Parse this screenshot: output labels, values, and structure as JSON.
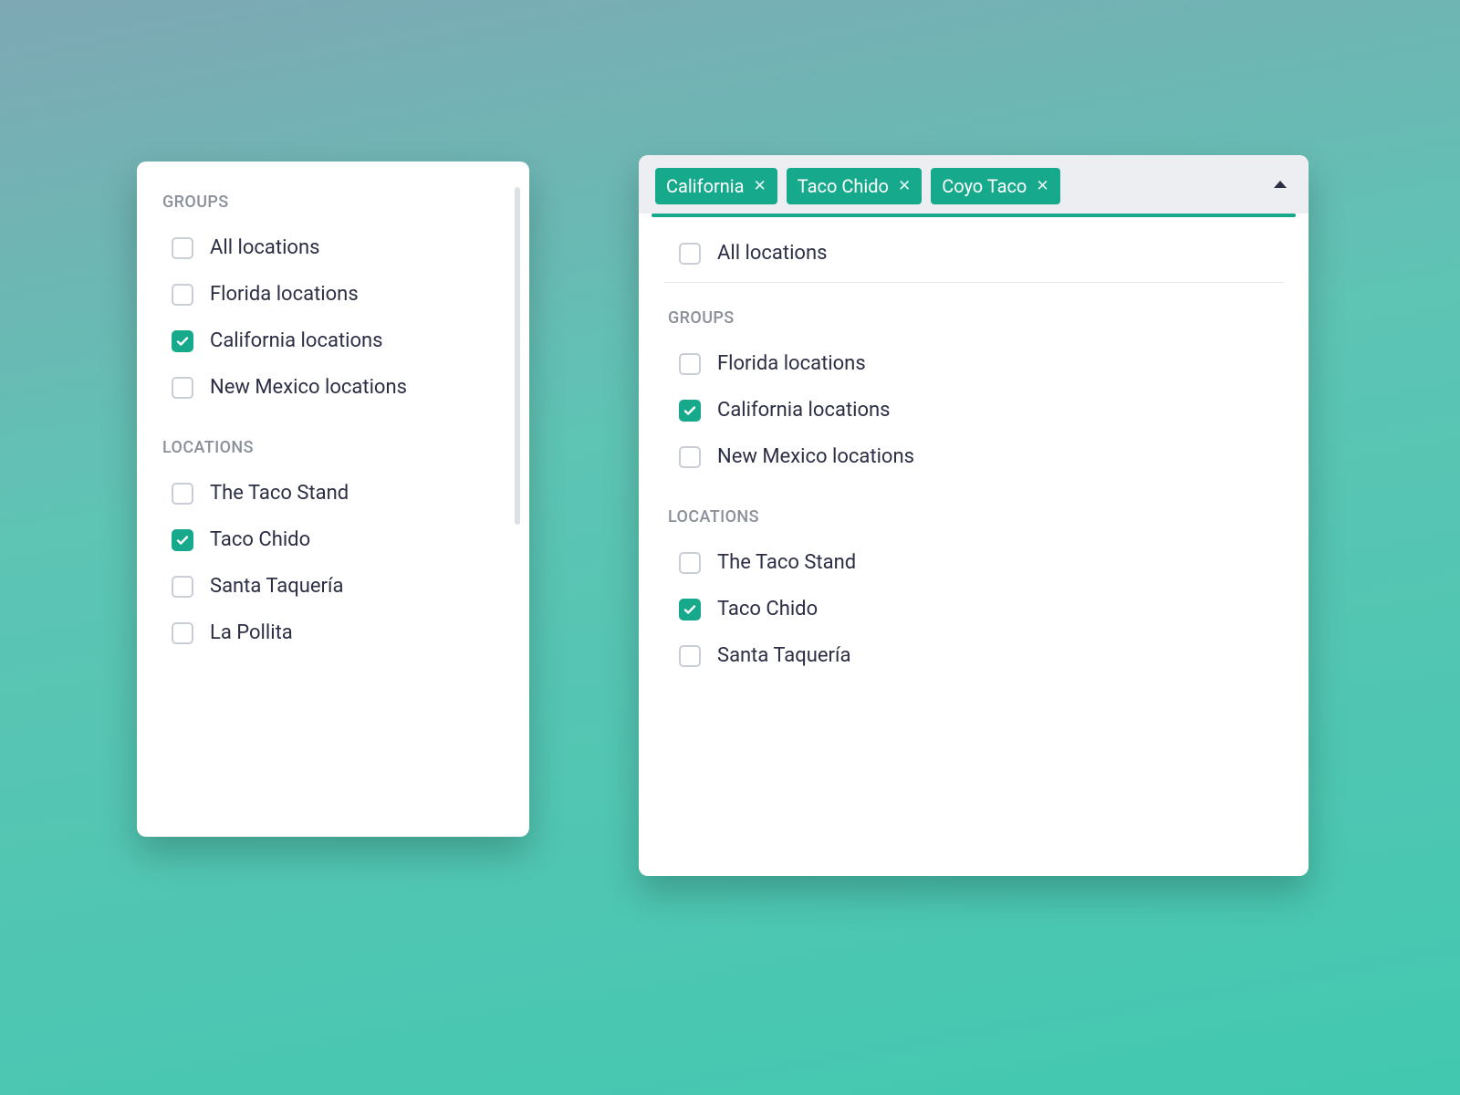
{
  "colors": {
    "accent": "#17a98c"
  },
  "panel_small": {
    "sections": [
      {
        "header": "GROUPS",
        "items": [
          {
            "label": "All locations",
            "checked": false
          },
          {
            "label": "Florida locations",
            "checked": false
          },
          {
            "label": "California locations",
            "checked": true
          },
          {
            "label": "New Mexico locations",
            "checked": false
          }
        ]
      },
      {
        "header": "LOCATIONS",
        "items": [
          {
            "label": "The Taco Stand",
            "checked": false
          },
          {
            "label": "Taco Chido",
            "checked": true
          },
          {
            "label": "Santa Taquería",
            "checked": false
          },
          {
            "label": "La Pollita",
            "checked": false
          }
        ]
      }
    ]
  },
  "panel_large": {
    "chips": [
      {
        "label": "California"
      },
      {
        "label": "Taco Chido"
      },
      {
        "label": "Coyo Taco"
      }
    ],
    "top_item": {
      "label": "All locations",
      "checked": false
    },
    "sections": [
      {
        "header": "GROUPS",
        "items": [
          {
            "label": "Florida locations",
            "checked": false
          },
          {
            "label": "California locations",
            "checked": true
          },
          {
            "label": "New Mexico locations",
            "checked": false
          }
        ]
      },
      {
        "header": "LOCATIONS",
        "items": [
          {
            "label": "The Taco Stand",
            "checked": false
          },
          {
            "label": "Taco Chido",
            "checked": true
          },
          {
            "label": "Santa Taquería",
            "checked": false
          }
        ]
      }
    ]
  }
}
